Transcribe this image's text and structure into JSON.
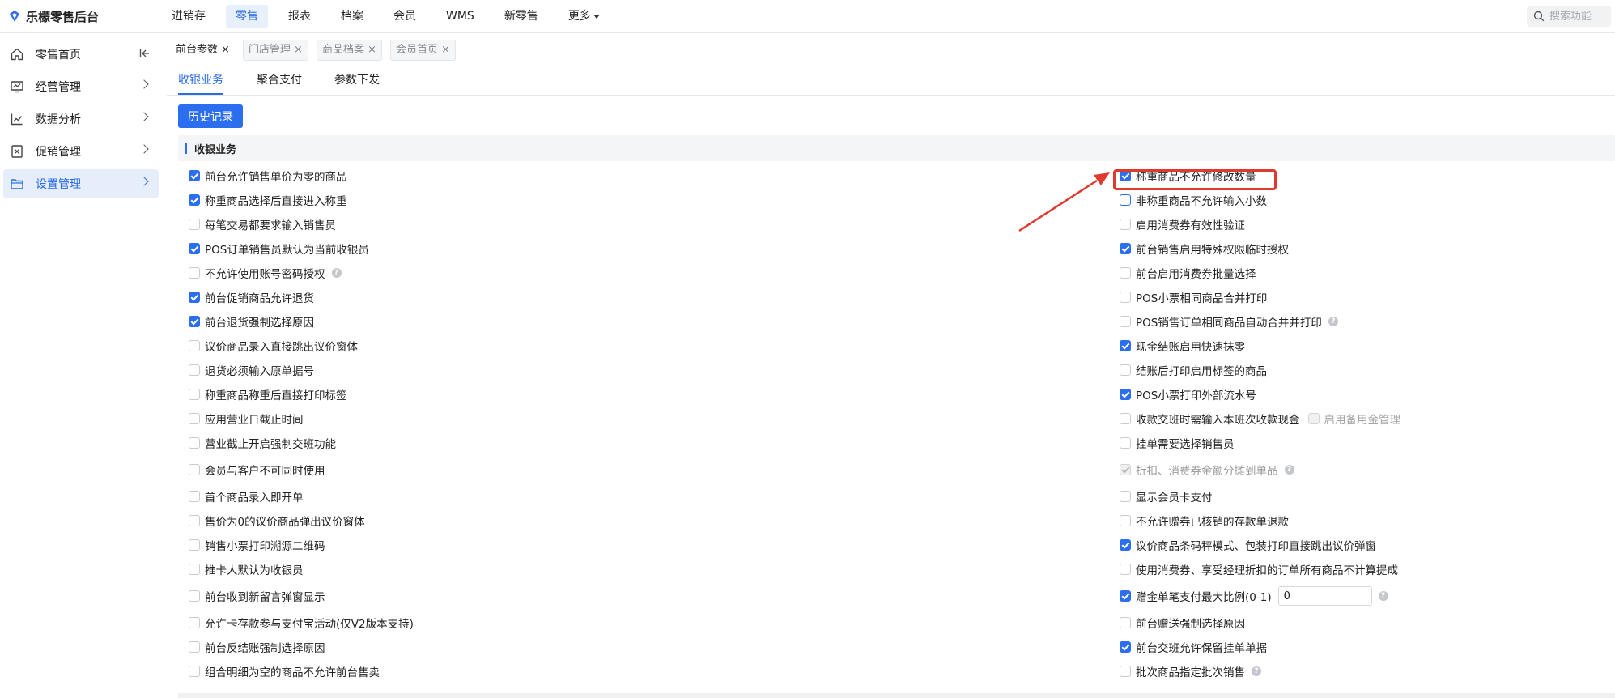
{
  "app": {
    "name": "乐檬零售后台"
  },
  "nav": {
    "items": [
      {
        "label": "进销存",
        "active": false
      },
      {
        "label": "零售",
        "active": true
      },
      {
        "label": "报表",
        "active": false
      },
      {
        "label": "档案",
        "active": false
      },
      {
        "label": "会员",
        "active": false
      },
      {
        "label": "WMS",
        "active": false
      },
      {
        "label": "新零售",
        "active": false
      },
      {
        "label": "更多",
        "active": false
      }
    ],
    "search_placeholder": "搜索功能"
  },
  "sidebar": {
    "items": [
      {
        "label": "零售首页",
        "icon": "home-icon",
        "active": false
      },
      {
        "label": "经营管理",
        "icon": "monitor-chart-icon",
        "active": false
      },
      {
        "label": "数据分析",
        "icon": "line-chart-icon",
        "active": false
      },
      {
        "label": "促销管理",
        "icon": "promotion-icon",
        "active": false
      },
      {
        "label": "设置管理",
        "icon": "folder-icon",
        "active": true
      }
    ]
  },
  "page_tabs": [
    {
      "label": "前台参数",
      "active": true
    },
    {
      "label": "门店管理",
      "active": false
    },
    {
      "label": "商品档案",
      "active": false
    },
    {
      "label": "会员首页",
      "active": false
    }
  ],
  "sub_tabs": [
    {
      "label": "收银业务",
      "active": true
    },
    {
      "label": "聚合支付",
      "active": false
    },
    {
      "label": "参数下发",
      "active": false
    }
  ],
  "history_button": "历史记录",
  "section_title": "收银业务",
  "left_options": [
    {
      "label": "前台允许销售单价为零的商品",
      "checked": true
    },
    {
      "label": "称重商品选择后直接进入称重",
      "checked": true
    },
    {
      "label": "每笔交易都要求输入销售员",
      "checked": false
    },
    {
      "label": "POS订单销售员默认为当前收银员",
      "checked": true
    },
    {
      "label": "不允许使用账号密码授权",
      "checked": false,
      "help": true
    },
    {
      "label": "前台促销商品允许退货",
      "checked": true
    },
    {
      "label": "前台退货强制选择原因",
      "checked": true
    },
    {
      "label": "议价商品录入直接跳出议价窗体",
      "checked": false
    },
    {
      "label": "退货必须输入原单据号",
      "checked": false
    },
    {
      "label": "称重商品称重后直接打印标签",
      "checked": false
    },
    {
      "label": "应用营业日截止时间",
      "checked": false
    },
    {
      "label": "营业截止开启强制交班功能",
      "checked": false
    },
    {
      "label": "会员与客户不可同时使用",
      "checked": false
    },
    {
      "label": "首个商品录入即开单",
      "checked": false
    },
    {
      "label": "售价为0的议价商品弹出议价窗体",
      "checked": false
    },
    {
      "label": "销售小票打印溯源二维码",
      "checked": false
    },
    {
      "label": "推卡人默认为收银员",
      "checked": false
    },
    {
      "label": "前台收到新留言弹窗显示",
      "checked": false
    },
    {
      "label": "允许卡存款参与支付宝活动(仅V2版本支持)",
      "checked": false
    },
    {
      "label": "前台反结账强制选择原因",
      "checked": false
    },
    {
      "label": "组合明细为空的商品不允许前台售卖",
      "checked": false
    }
  ],
  "right_options": [
    {
      "label": "称重商品不允许修改数量",
      "checked": true,
      "highlighted": true
    },
    {
      "label": "非称重商品不允许输入小数",
      "checked": false,
      "focus": true
    },
    {
      "label": "启用消费券有效性验证",
      "checked": false
    },
    {
      "label": "前台销售启用特殊权限临时授权",
      "checked": true
    },
    {
      "label": "前台启用消费券批量选择",
      "checked": false
    },
    {
      "label": "POS小票相同商品合并打印",
      "checked": false
    },
    {
      "label": "POS销售订单相同商品自动合并并打印",
      "checked": false,
      "help": true
    },
    {
      "label": "现金结账启用快速抹零",
      "checked": true
    },
    {
      "label": "结账后打印启用标签的商品",
      "checked": false
    },
    {
      "label": "POS小票打印外部流水号",
      "checked": true
    },
    {
      "label": "收款交班时需输入本班次收款现金",
      "checked": false,
      "sub_option": {
        "label": "启用备用金管理",
        "checked": false
      }
    },
    {
      "label": "挂单需要选择销售员",
      "checked": false
    },
    {
      "label": "折扣、消费券金额分摊到单品",
      "checked": true,
      "disabled": true,
      "help": true
    },
    {
      "label": "显示会员卡支付",
      "checked": false
    },
    {
      "label": "不允许赠券已核销的存款单退款",
      "checked": false
    },
    {
      "label": "议价商品条码秤模式、包装打印直接跳出议价弹窗",
      "checked": true
    },
    {
      "label": "使用消费券、享受经理折扣的订单所有商品不计算提成",
      "checked": false
    },
    {
      "label": "赠金单笔支付最大比例(0-1)",
      "checked": true,
      "input_value": "0",
      "help": true
    },
    {
      "label": "前台赠送强制选择原因",
      "checked": false
    },
    {
      "label": "前台交班允许保留挂单单据",
      "checked": true
    },
    {
      "label": "批次商品指定批次销售",
      "checked": false,
      "help": true
    }
  ],
  "colors": {
    "accent": "#2b6ef0",
    "highlight": "#e03a2f"
  }
}
